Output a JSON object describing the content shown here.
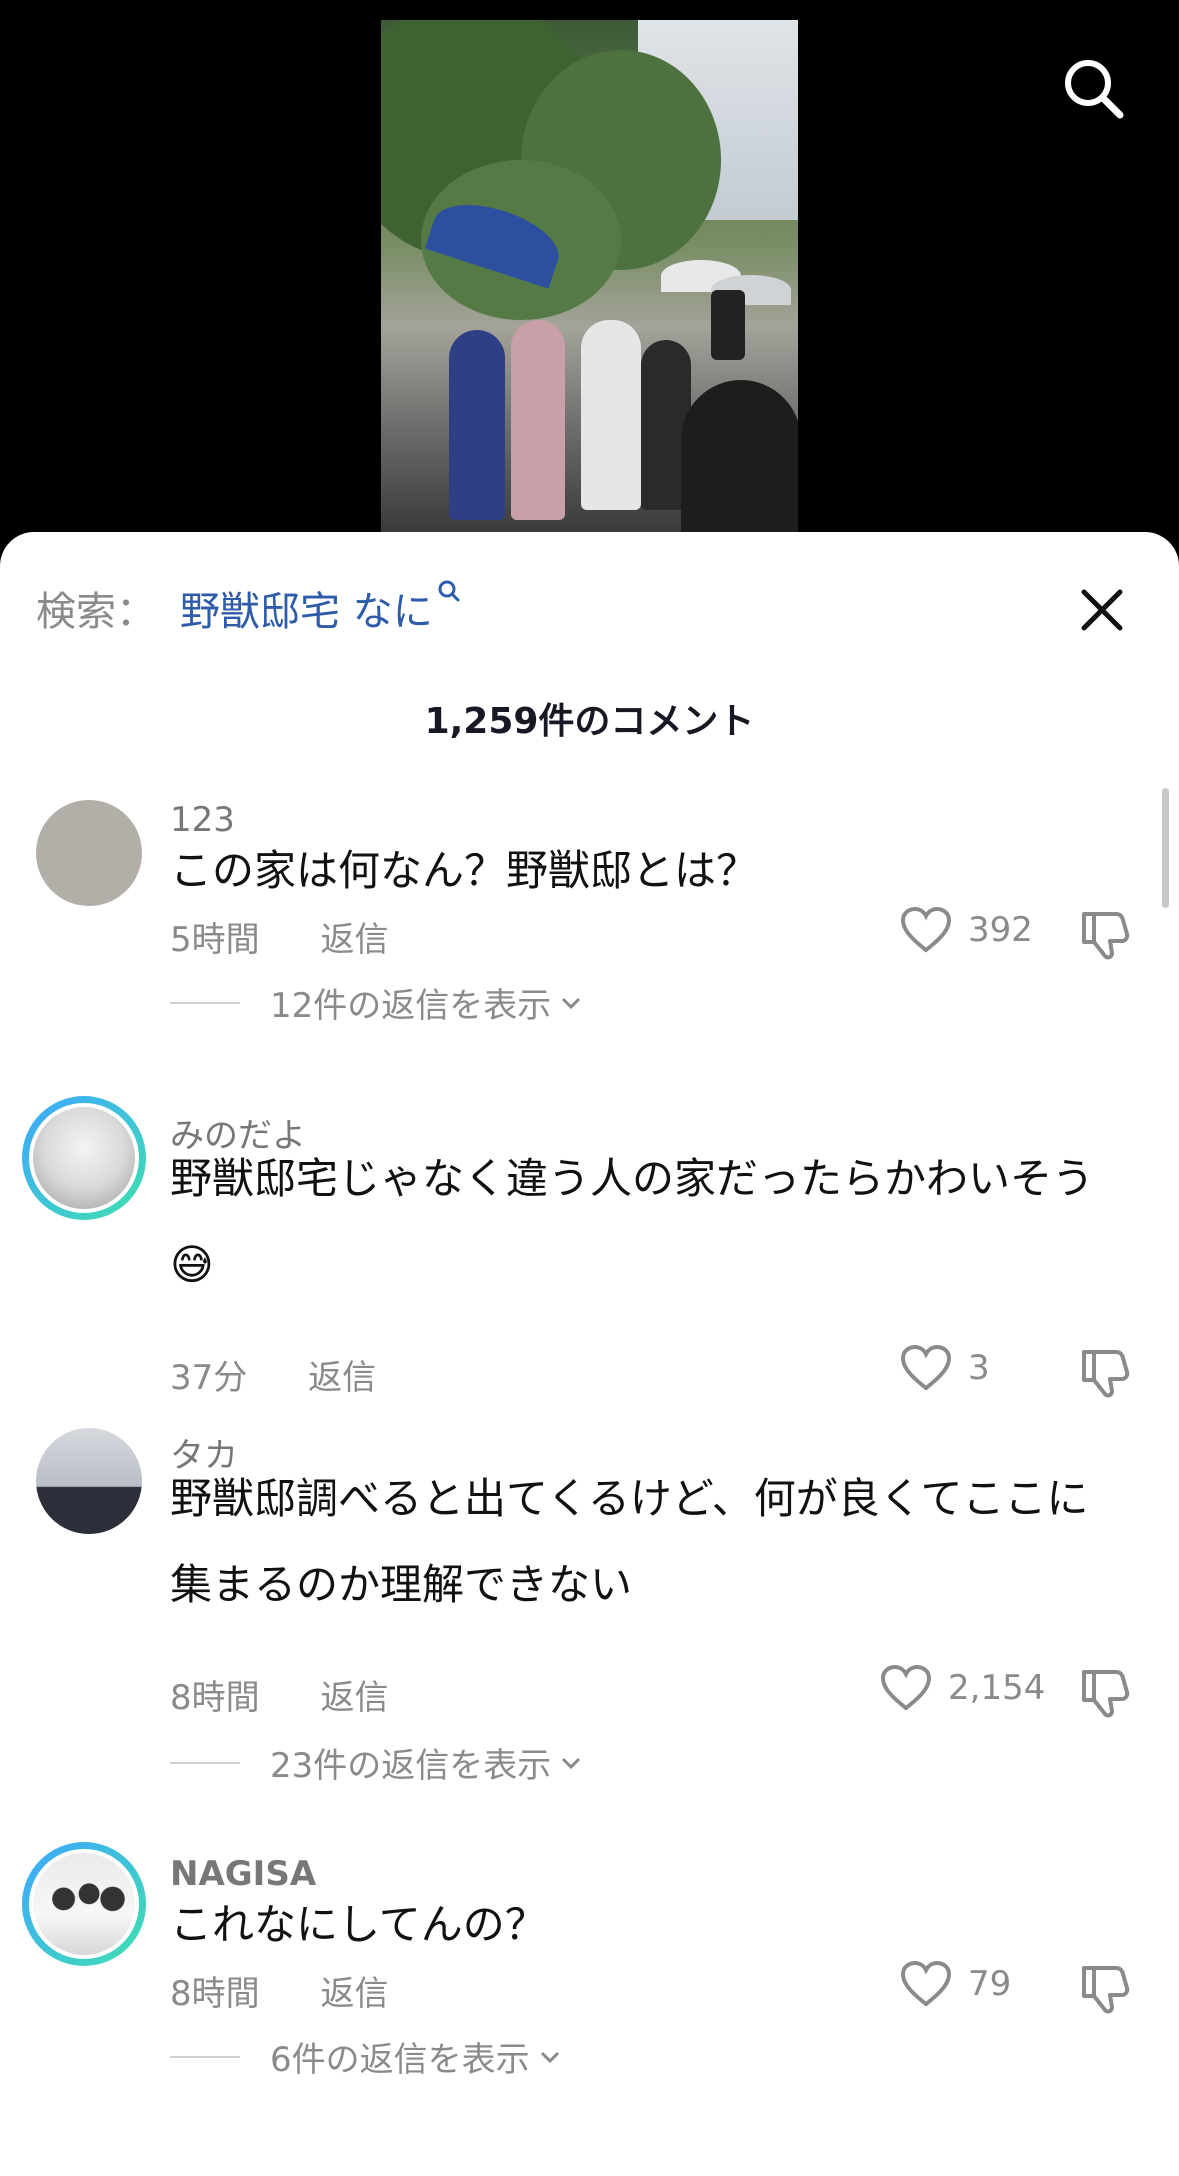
{
  "search": {
    "label": "検索：",
    "term": "野獣邸宅 なに"
  },
  "comment_count": "1,259件のコメント",
  "comments": [
    {
      "username": "123",
      "text": "この家は何なん？野獣邸とは？",
      "time": "5時間",
      "reply_label": "返信",
      "likes": "392",
      "view_replies": "12件の返信を表示"
    },
    {
      "username": "みのだよ",
      "text": "野獣邸宅じゃなく違う人の家だったらかわいそう😅",
      "time": "37分",
      "reply_label": "返信",
      "likes": "3",
      "view_replies": ""
    },
    {
      "username": "タカ",
      "text": "野獣邸調べると出てくるけど、何が良くてここに集まるのか理解できない",
      "time": "8時間",
      "reply_label": "返信",
      "likes": "2,154",
      "view_replies": "23件の返信を表示"
    },
    {
      "username": "NAGISA",
      "text": "これなにしてんの？",
      "time": "8時間",
      "reply_label": "返信",
      "likes": "79",
      "view_replies": "6件の返信を表示"
    }
  ],
  "colors": {
    "search_term": "#2e5ca8",
    "avatar_ring_start": "#3ea6ff",
    "avatar_ring_end": "#3fe0b0"
  },
  "icons": [
    "search-icon",
    "close-icon",
    "heart-icon",
    "dislike-icon",
    "chevron-down-icon"
  ]
}
